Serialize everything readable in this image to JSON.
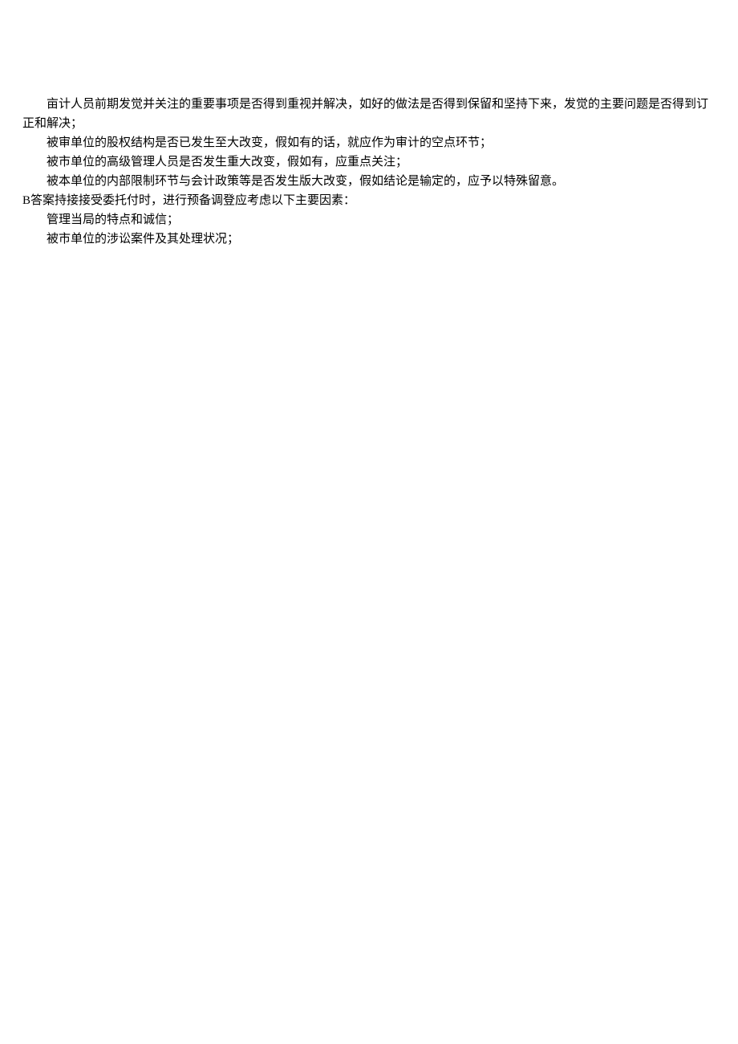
{
  "paragraphs": [
    {
      "text": "亩计人员前期发觉并关注的重要事项是否得到重视并解决，如好的做法是否得到保留和坚持下来，发觉的主要问题是否得到订正和解决；",
      "indented": true,
      "continuation": true
    },
    {
      "text": "被审单位的股权结构是否已发生至大改变，假如有的话，就应作为审计的空点环节；",
      "indented": true
    },
    {
      "text": "被市单位的高级管理人员是否发生重大改变，假如有，应重点关注；",
      "indented": true
    },
    {
      "text": "被本单位的内部限制环节与会计政策等是否发生版大改变，假如结论是输定的，应予以特殊留意。",
      "indented": true
    },
    {
      "text": "B答案持接接受委托付时，进行预备调登应考虑以下主要因素：",
      "indented": false
    },
    {
      "text": "管理当局的特点和诚信；",
      "indented": true
    },
    {
      "text": "被市单位的涉讼案件及其处理状况；",
      "indented": true
    }
  ]
}
